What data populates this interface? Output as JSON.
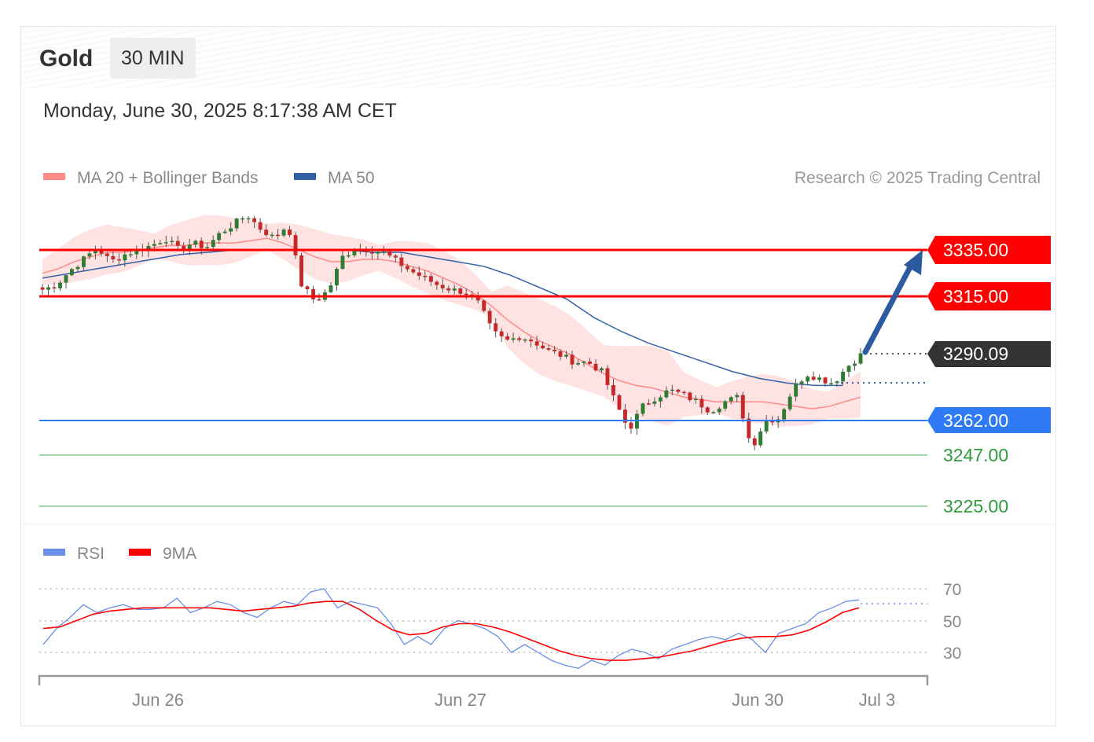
{
  "header": {
    "instrument": "Gold",
    "timeframe": "30 MIN",
    "timestamp": "Monday, June 30, 2025 8:17:38 AM CET"
  },
  "legend": {
    "ma20": "MA 20 + Bollinger Bands",
    "ma50": "MA 50",
    "copyright": "Research © 2025 Trading Central",
    "rsi": "RSI",
    "rsi_ma": "9MA"
  },
  "colors": {
    "resistance": "#ff0000",
    "support": "#2f7bf5",
    "support_target": "#4caf50",
    "current": "#333333",
    "ma20": "#ff8a8a",
    "ma50": "#3460a8",
    "bull": "#2e7d32",
    "bear": "#c62828",
    "arrow": "#2c5aa0",
    "rsi": "#6a8ee8",
    "rsi_ma": "#ff0000"
  },
  "levels": {
    "r1": "3335.00",
    "r2": "3315.00",
    "current": "3290.09",
    "s1": "3262.00",
    "s2": "3247.00",
    "s3": "3225.00"
  },
  "chart_data": [
    {
      "type": "candlestick",
      "title": "Gold",
      "timeframe": "30 MIN",
      "x_ticks": [
        "Jun 26",
        "Jun 27",
        "Jun 30",
        "Jul 3"
      ],
      "price_levels": [
        {
          "value": 3335.0,
          "role": "resistance"
        },
        {
          "value": 3315.0,
          "role": "resistance"
        },
        {
          "value": 3290.09,
          "role": "current"
        },
        {
          "value": 3262.0,
          "role": "support"
        },
        {
          "value": 3247.0,
          "role": "support"
        },
        {
          "value": 3225.0,
          "role": "support"
        }
      ],
      "ylim": [
        3210,
        3375
      ],
      "close_path": [
        3318,
        3320,
        3326,
        3331,
        3336,
        3330,
        3333,
        3335,
        3337,
        3340,
        3335,
        3338,
        3336,
        3342,
        3346,
        3350,
        3344,
        3340,
        3346,
        3320,
        3313,
        3318,
        3332,
        3336,
        3335,
        3334,
        3330,
        3326,
        3323,
        3320,
        3318,
        3317,
        3312,
        3300,
        3296,
        3298,
        3296,
        3292,
        3290,
        3287,
        3287,
        3283,
        3270,
        3258,
        3268,
        3272,
        3275,
        3273,
        3270,
        3266,
        3270,
        3272,
        3250,
        3262,
        3263,
        3275,
        3282,
        3280,
        3278,
        3285,
        3290
      ],
      "series": [
        {
          "name": "MA 20 + Bollinger Bands",
          "values": [
            3325,
            3327,
            3330,
            3332,
            3334,
            3334,
            3335,
            3336,
            3337,
            3337,
            3338,
            3338,
            3338,
            3339,
            3340,
            3338,
            3335,
            3332,
            3330,
            3330,
            3331,
            3331,
            3330,
            3328,
            3326,
            3323,
            3320,
            3316,
            3311,
            3305,
            3300,
            3296,
            3293,
            3290,
            3286,
            3282,
            3279,
            3277,
            3276,
            3274,
            3272,
            3271,
            3270,
            3270,
            3270,
            3270,
            3269,
            3268,
            3267,
            3268,
            3270,
            3272
          ]
        },
        {
          "name": "MA 50",
          "values": [
            3323,
            3325,
            3327,
            3329,
            3331,
            3333,
            3334,
            3335,
            3335,
            3335,
            3335,
            3335,
            3334,
            3334,
            3332,
            3330,
            3328,
            3324,
            3319,
            3314,
            3306,
            3300,
            3295,
            3291,
            3287,
            3283,
            3280,
            3278,
            3277,
            3277
          ]
        }
      ]
    },
    {
      "type": "line",
      "series_names": [
        "RSI",
        "9MA"
      ],
      "y_ticks": [
        70,
        50,
        30
      ],
      "ylim": [
        20,
        75
      ],
      "series": [
        {
          "name": "RSI",
          "values": [
            35,
            45,
            52,
            60,
            55,
            58,
            60,
            57,
            57,
            58,
            64,
            55,
            58,
            62,
            60,
            55,
            52,
            58,
            62,
            60,
            68,
            70,
            58,
            62,
            60,
            58,
            48,
            35,
            40,
            35,
            45,
            50,
            48,
            45,
            40,
            30,
            35,
            30,
            25,
            22,
            20,
            25,
            22,
            28,
            32,
            30,
            26,
            32,
            35,
            38,
            40,
            38,
            42,
            38,
            30,
            42,
            45,
            48,
            55,
            58,
            62,
            63
          ]
        },
        {
          "name": "9MA",
          "values": [
            45,
            46,
            50,
            54,
            56,
            57,
            58,
            58,
            58,
            58,
            58,
            57,
            56,
            57,
            58,
            59,
            61,
            62,
            62,
            57,
            50,
            44,
            41,
            42,
            46,
            48,
            48,
            46,
            43,
            39,
            35,
            31,
            28,
            26,
            25,
            25,
            26,
            27,
            29,
            31,
            34,
            37,
            39,
            40,
            40,
            41,
            44,
            49,
            55,
            58
          ]
        }
      ]
    }
  ]
}
